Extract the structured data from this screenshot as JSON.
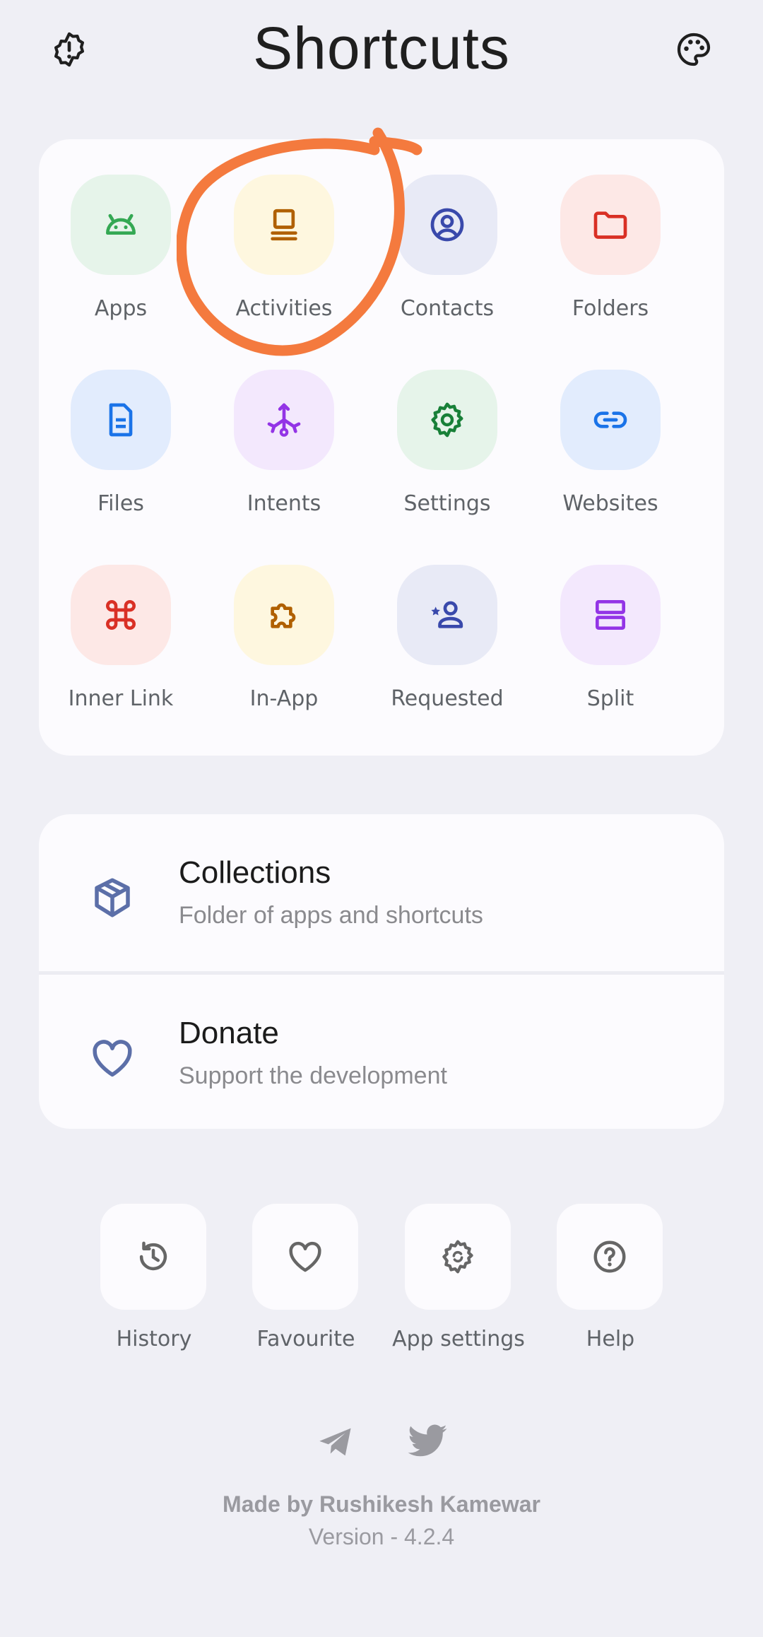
{
  "header": {
    "title": "Shortcuts",
    "left_icon": "alert-badge-icon",
    "right_icon": "palette-icon"
  },
  "grid": [
    {
      "label": "Apps",
      "icon": "android-icon",
      "bg": "#e6f4ea",
      "fg": "#34a853"
    },
    {
      "label": "Activities",
      "icon": "activities-icon",
      "bg": "#fef7df",
      "fg": "#b06000"
    },
    {
      "label": "Contacts",
      "icon": "contact-icon",
      "bg": "#e8eaf6",
      "fg": "#3949ab"
    },
    {
      "label": "Folders",
      "icon": "folder-icon",
      "bg": "#fde8e6",
      "fg": "#d93025"
    },
    {
      "label": "Files",
      "icon": "file-icon",
      "bg": "#e2ecfd",
      "fg": "#1a73e8"
    },
    {
      "label": "Intents",
      "icon": "intents-icon",
      "bg": "#f3e8fd",
      "fg": "#9334e6"
    },
    {
      "label": "Settings",
      "icon": "gear-icon",
      "bg": "#e6f4ea",
      "fg": "#188038"
    },
    {
      "label": "Websites",
      "icon": "link-icon",
      "bg": "#e2ecfd",
      "fg": "#1a73e8"
    },
    {
      "label": "Inner Link",
      "icon": "command-icon",
      "bg": "#fde8e6",
      "fg": "#d93025"
    },
    {
      "label": "In-App",
      "icon": "puzzle-icon",
      "bg": "#fef7df",
      "fg": "#b06000"
    },
    {
      "label": "Requested",
      "icon": "person-star-icon",
      "bg": "#e8eaf6",
      "fg": "#3949ab"
    },
    {
      "label": "Split",
      "icon": "split-icon",
      "bg": "#f3e8fd",
      "fg": "#9334e6"
    }
  ],
  "list": [
    {
      "title": "Collections",
      "subtitle": "Folder of apps and shortcuts",
      "icon": "box-icon"
    },
    {
      "title": "Donate",
      "subtitle": "Support the development",
      "icon": "heart-icon"
    }
  ],
  "quick": [
    {
      "label": "History",
      "icon": "history-icon"
    },
    {
      "label": "Favourite",
      "icon": "heart-icon"
    },
    {
      "label": "App settings",
      "icon": "gear-sync-icon"
    },
    {
      "label": "Help",
      "icon": "help-icon"
    }
  ],
  "social": [
    "telegram-icon",
    "twitter-icon"
  ],
  "footer": {
    "credit": "Made by Rushikesh Kamewar",
    "version": "Version - 4.2.4"
  },
  "colors": {
    "background": "#efeff5",
    "card": "#fcfbfe",
    "accent_list_icon": "#5c6fa8",
    "annotation": "#f47a3e"
  }
}
